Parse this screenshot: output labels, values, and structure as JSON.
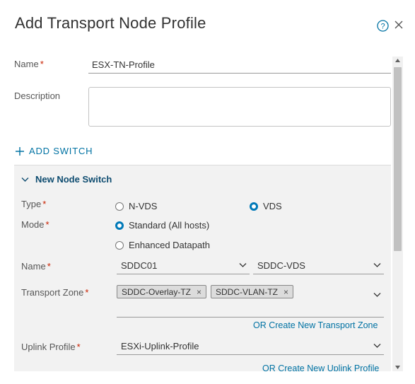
{
  "dialog": {
    "title": "Add Transport Node Profile",
    "help_icon": "help-circle-icon",
    "close_icon": "close-icon"
  },
  "form": {
    "name_label": "Name",
    "name_value": "ESX-TN-Profile",
    "description_label": "Description",
    "description_value": "",
    "required_marker": "*",
    "add_switch_label": "ADD SWITCH"
  },
  "switch": {
    "header": "New Node Switch",
    "type_label": "Type",
    "type_options": [
      {
        "label": "N-VDS",
        "selected": false
      },
      {
        "label": "VDS",
        "selected": true
      }
    ],
    "mode_label": "Mode",
    "mode_options": [
      {
        "label": "Standard (All hosts)",
        "selected": true
      },
      {
        "label": "Enhanced Datapath",
        "selected": false
      }
    ],
    "name_label": "Name",
    "vcenter_value": "SDDC01",
    "vds_value": "SDDC-VDS",
    "transport_zone_label": "Transport Zone",
    "transport_zones": [
      "SDDC-Overlay-TZ",
      "SDDC-VLAN-TZ"
    ],
    "create_tz_link": "OR Create New Transport Zone",
    "uplink_profile_label": "Uplink Profile",
    "uplink_profile_value": "ESXi-Uplink-Profile",
    "create_uplink_link": "OR Create New Uplink Profile"
  },
  "colors": {
    "accent": "#0072a3",
    "required": "#c92100",
    "panel_bg": "#f2f2f2"
  }
}
